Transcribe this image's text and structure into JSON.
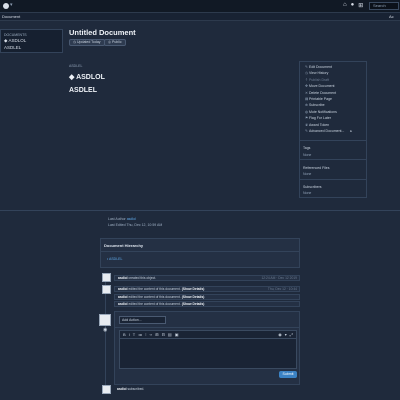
{
  "topbar": {
    "caret": "▾",
    "icons": [
      "home-icon",
      "bell-icon",
      "app-icon"
    ],
    "icon_glyphs": [
      "⌂",
      "●",
      "⊞"
    ],
    "search_placeholder": "Search"
  },
  "crumbbar": {
    "label": "Document",
    "right": "Ac"
  },
  "leftnav": {
    "title": "DOCUMENTS",
    "items": [
      {
        "icon": "document-icon",
        "label": "ASDLOL"
      },
      {
        "label": "ASDLEL"
      }
    ]
  },
  "document": {
    "title": "Untitled Document",
    "tags": [
      {
        "label": "Updated Today"
      },
      {
        "label": "Public"
      }
    ],
    "section_label": "ASDLEL",
    "headings": [
      "ASDLOL",
      "ASDLEL"
    ]
  },
  "actions": {
    "items": [
      {
        "label": "Edit Document",
        "icon": "pencil-icon",
        "glyph": "✎",
        "disabled": false
      },
      {
        "label": "View History",
        "icon": "history-icon",
        "glyph": "◷",
        "disabled": false
      },
      {
        "label": "Publish Draft",
        "icon": "upload-icon",
        "glyph": "⇡",
        "disabled": true
      },
      {
        "label": "Move Document",
        "icon": "move-icon",
        "glyph": "✥",
        "disabled": false
      },
      {
        "label": "Delete Document",
        "icon": "trash-icon",
        "glyph": "✕",
        "disabled": false
      },
      {
        "label": "Printable Page",
        "icon": "print-icon",
        "glyph": "▤",
        "disabled": false
      },
      {
        "label": "Subscribe",
        "icon": "plus-circle-icon",
        "glyph": "⊕",
        "disabled": false
      },
      {
        "label": "Mute Notifications",
        "icon": "mute-icon",
        "glyph": "◍",
        "disabled": false
      },
      {
        "label": "Flag For Later",
        "icon": "flag-icon",
        "glyph": "⚑",
        "disabled": false
      },
      {
        "label": "Award Token",
        "icon": "trophy-icon",
        "glyph": "♛",
        "disabled": false
      },
      {
        "label": "Advanced Document...",
        "icon": "wrench-icon",
        "glyph": "✎",
        "disabled": false,
        "submenu": "▸"
      }
    ],
    "info": [
      {
        "label": "Tags",
        "value": "None"
      },
      {
        "label": "Referenced Files",
        "value": "None"
      },
      {
        "label": "Subscribers",
        "value": "None"
      }
    ]
  },
  "meta": {
    "last_author_label": "Last Author",
    "last_author": "asdlol",
    "last_edited_label": "Last Edited",
    "last_edited": "Thu, Dec 12, 10:59 AM"
  },
  "hierarchy": {
    "title": "Document Hierarchy",
    "items": [
      "ASDLEL"
    ]
  },
  "timeline": [
    {
      "text_pre": "asdlol",
      "text_mid": " created this object.",
      "time": "12:24 AM · Dec 12 2019",
      "avatar": true
    },
    {
      "text_pre": "asdlol",
      "text_mid": " edited the content of this document.",
      "link": "(Show Details)",
      "time": "Thu, Dec 12 · 10:44",
      "avatar": true
    },
    {
      "text_pre": "asdlol",
      "text_mid": " edited the content of this document.",
      "link": "(Show Details)",
      "time": "",
      "avatar": false
    },
    {
      "text_pre": "asdlol",
      "text_mid": " edited the content of this document.",
      "link": "(Show Details)",
      "time": "",
      "avatar": false
    }
  ],
  "editor": {
    "title_placeholder": "Add Action...",
    "toolbar_left": [
      "B",
      "I",
      "T",
      "≔",
      "⁝",
      "‹›",
      "⊞",
      "⊟",
      "▤",
      "▣"
    ],
    "toolbar_right": [
      "◉",
      "▾",
      "⤢"
    ],
    "submit_label": "Submit",
    "preview_glyph": "◉"
  },
  "last_entry": {
    "text_pre": "asdlol",
    "text_mid": " subscribed."
  }
}
